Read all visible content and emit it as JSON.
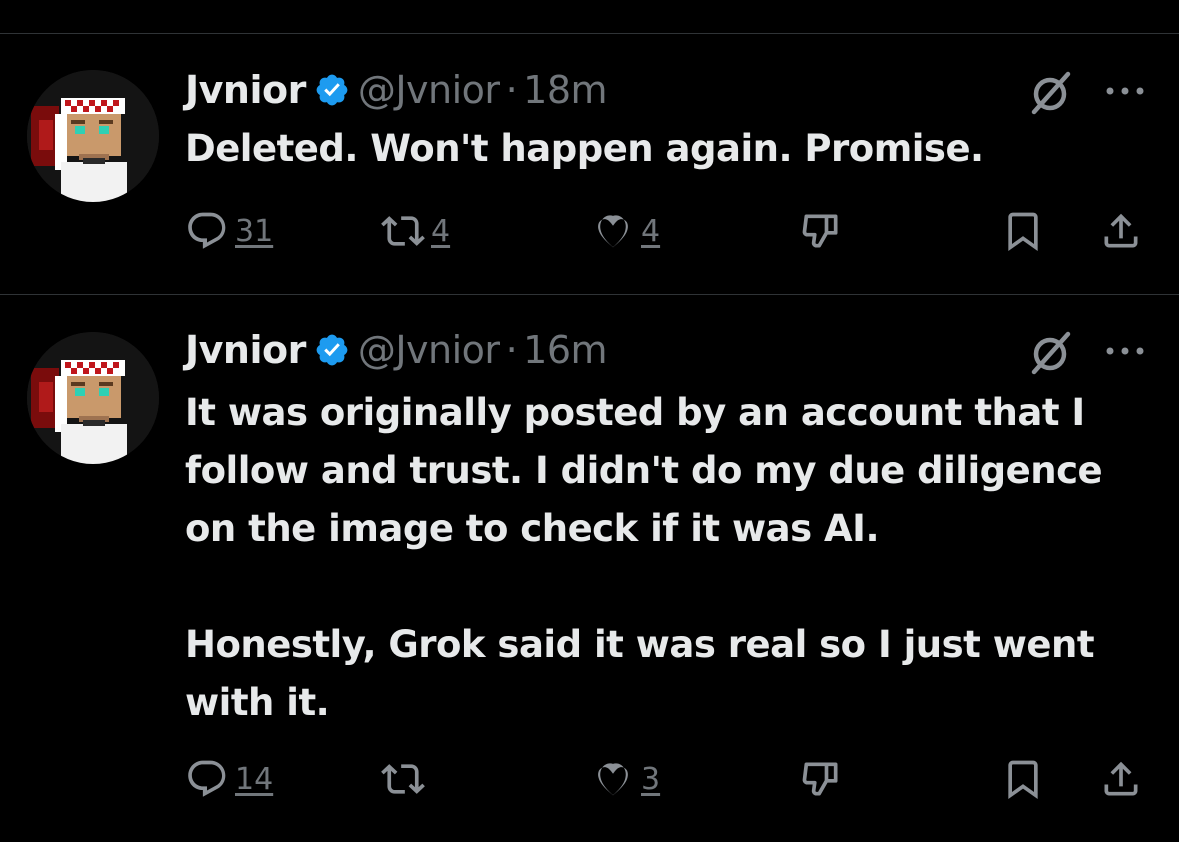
{
  "colors": {
    "background": "#000000",
    "text": "#e7e9ea",
    "muted": "#71767b",
    "verified": "#1d9bf0",
    "divider": "#2f3336"
  },
  "tweets": [
    {
      "author": "Jvnior",
      "handle": "@Jvnior",
      "separator": "·",
      "time": "18m",
      "paragraphs": [
        "Deleted. Won't happen again. Promise."
      ],
      "replies": "31",
      "reposts": "4",
      "likes": "4",
      "icons": [
        "verified-badge-icon",
        "grok-icon",
        "more-icon",
        "reply-icon",
        "repost-icon",
        "like-icon",
        "dislike-icon",
        "bookmark-icon",
        "share-icon"
      ]
    },
    {
      "author": "Jvnior",
      "handle": "@Jvnior",
      "separator": "·",
      "time": "16m",
      "paragraphs": [
        "It was originally posted by an account that I follow and trust. I didn't do my due diligence on the image to check if it was AI.",
        "Honestly, Grok said it was real so I just went with it."
      ],
      "replies": "14",
      "reposts": "",
      "likes": "3",
      "icons": [
        "verified-badge-icon",
        "grok-icon",
        "more-icon",
        "reply-icon",
        "repost-icon",
        "like-icon",
        "dislike-icon",
        "bookmark-icon",
        "share-icon"
      ]
    }
  ]
}
